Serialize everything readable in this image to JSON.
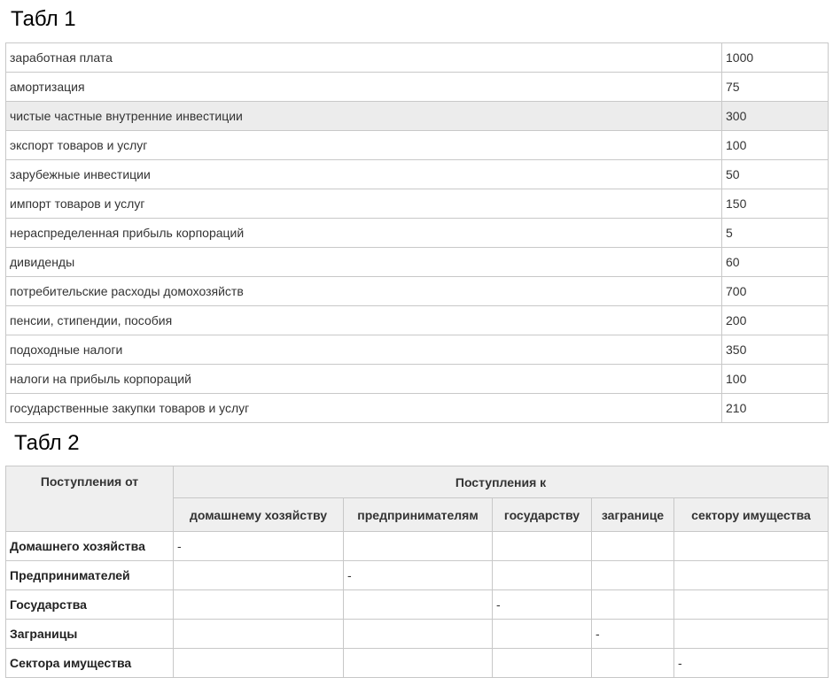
{
  "table1": {
    "caption": "Табл 1",
    "rows": [
      {
        "label": "заработная плата",
        "value": "1000"
      },
      {
        "label": "амортизация",
        "value": "75"
      },
      {
        "label": "чистые частные внутренние инвестиции",
        "value": "300"
      },
      {
        "label": "экспорт товаров и услуг",
        "value": "100"
      },
      {
        "label": "зарубежные инвестиции",
        "value": "50"
      },
      {
        "label": "импорт товаров и услуг",
        "value": "150"
      },
      {
        "label": "нераспределенная прибыль корпораций",
        "value": "5"
      },
      {
        "label": "дивиденды",
        "value": "60"
      },
      {
        "label": "потребительские расходы домохозяйств",
        "value": "700"
      },
      {
        "label": "пенсии, стипендии, пособия",
        "value": "200"
      },
      {
        "label": "подоходные налоги",
        "value": "350"
      },
      {
        "label": "налоги на прибыль корпораций",
        "value": "100"
      },
      {
        "label": "государственные закупки товаров и услуг",
        "value": "210"
      }
    ]
  },
  "table2": {
    "caption": "Табл 2",
    "header_from": "Поступления от",
    "header_to": "Поступления к",
    "columns": [
      "домашнему хозяйству",
      "предпринимателям",
      "государству",
      "загранице",
      "сектору имущества"
    ],
    "rows": [
      {
        "label": "Домашнего хозяйства",
        "cells": [
          "-",
          "",
          "",
          "",
          ""
        ]
      },
      {
        "label": "Предпринимателей",
        "cells": [
          "",
          "-",
          "",
          "",
          ""
        ]
      },
      {
        "label": "Государства",
        "cells": [
          "",
          "",
          "-",
          "",
          ""
        ]
      },
      {
        "label": "Заграницы",
        "cells": [
          "",
          "",
          "",
          "-",
          ""
        ]
      },
      {
        "label": "Сектора имущества",
        "cells": [
          "",
          "",
          "",
          "",
          "-"
        ]
      }
    ]
  }
}
